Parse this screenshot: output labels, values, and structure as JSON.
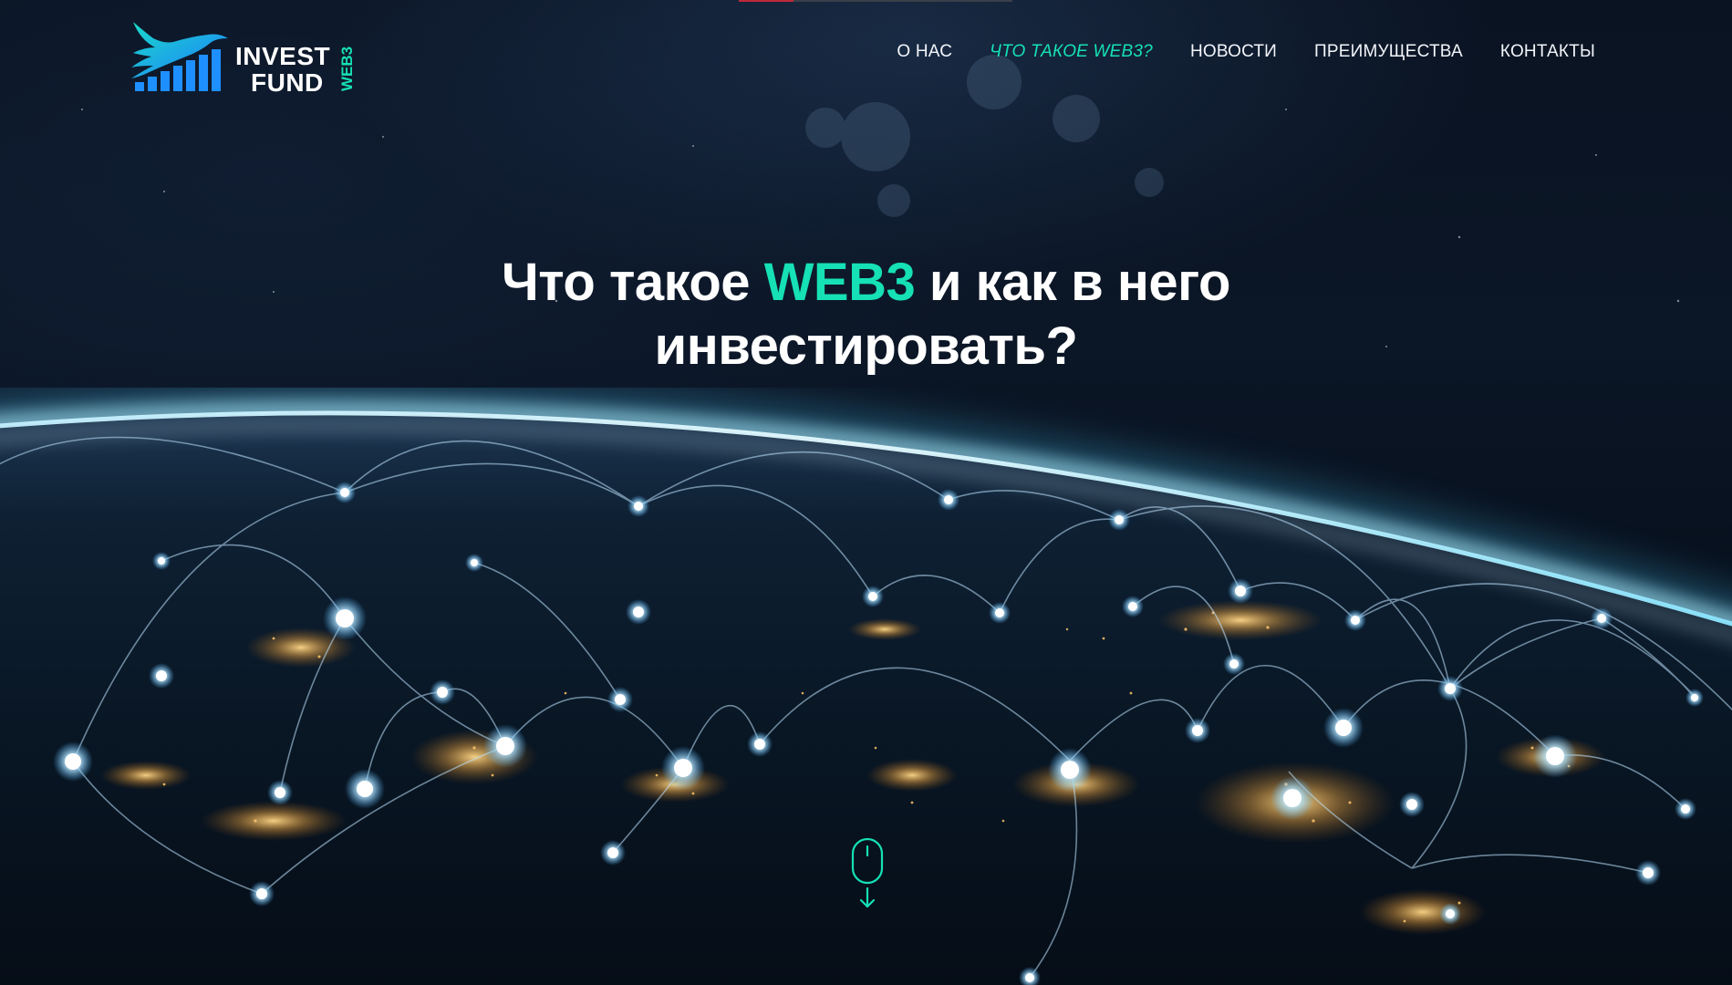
{
  "brand": {
    "line1": "INVEST",
    "line2": "FUND",
    "tag": "WEB3",
    "logo_icon": "eagle-over-bar-chart-icon"
  },
  "nav": {
    "items": [
      {
        "label": "О НАС"
      },
      {
        "label": "ЧТО ТАКОЕ WEB3?",
        "active": true
      },
      {
        "label": "НОВОСТИ"
      },
      {
        "label": "ПРЕИМУЩЕСТВА"
      },
      {
        "label": "КОНТАКТЫ"
      }
    ]
  },
  "hero": {
    "title_before": "Что такое ",
    "title_accent": "WEB3",
    "title_after": " и как в него",
    "title_line2": "инвестировать?",
    "background": "earth-from-space-network-image",
    "scroll_icon": "mouse-scroll-down-icon"
  },
  "colors": {
    "accent": "#16e0b5",
    "text": "#ffffff",
    "logo_blue": "#1e8fff"
  }
}
